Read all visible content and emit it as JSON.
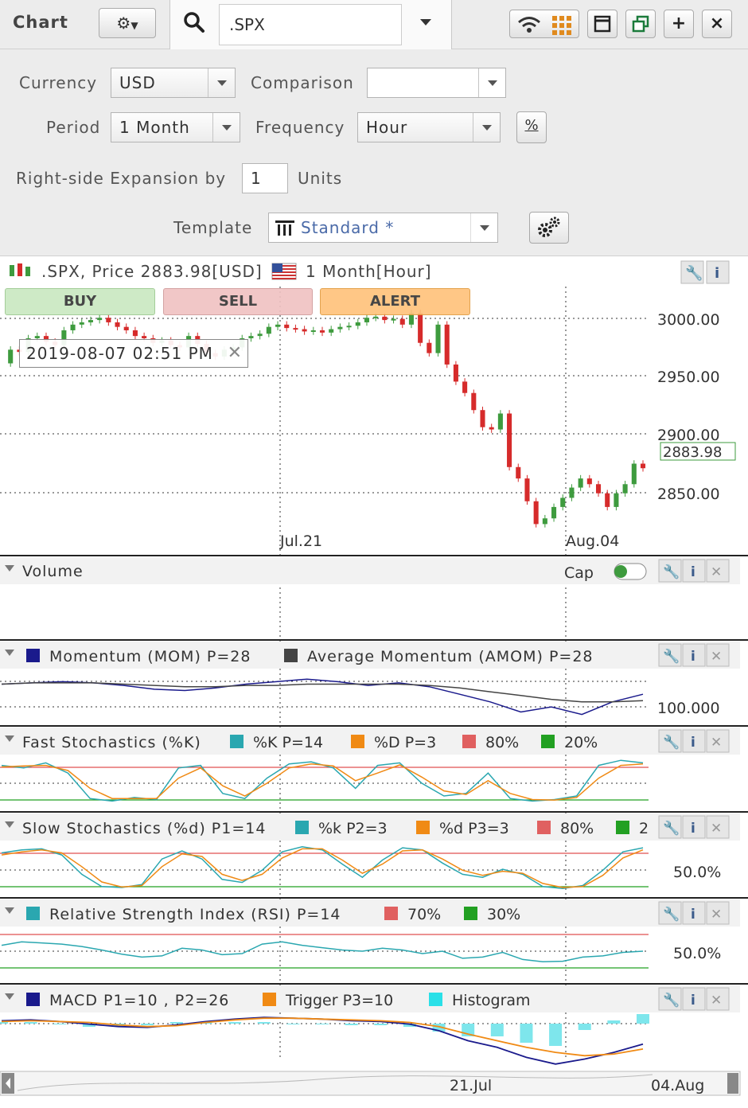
{
  "toolbar": {
    "title": "Chart",
    "symbol": ".SPX",
    "maximize_label": "+",
    "close_label": "×"
  },
  "settings": {
    "currency_label": "Currency",
    "currency_value": "USD",
    "comparison_label": "Comparison",
    "comparison_value": "",
    "period_label": "Period",
    "period_value": "1 Month",
    "frequency_label": "Frequency",
    "frequency_value": "Hour",
    "percent_label": "%",
    "expansion_label": "Right-side Expansion by",
    "expansion_value": "1",
    "units_label": "Units",
    "template_label": "Template",
    "template_value": "Standard *"
  },
  "price_panel": {
    "header": ".SPX, Price 2883.98[USD]",
    "period": "1 Month[Hour]",
    "buy_label": "BUY",
    "sell_label": "SELL",
    "alert_label": "ALERT",
    "crosshair_date": "2019-08-07 02:51 PM",
    "last_price": "2883.98",
    "y_ticks": [
      "3000.00",
      "2950.00",
      "2900.00",
      "2850.00"
    ],
    "x_ticks": [
      "Jul.21",
      "Aug.04"
    ]
  },
  "panels": {
    "volume": {
      "title": "Volume",
      "cap_label": "Cap"
    },
    "momentum": {
      "name1": "Momentum (MOM) P=28",
      "name2": "Average Momentum (AMOM) P=28",
      "tick": "100.000",
      "color1": "#1a1a8c",
      "color2": "#444444"
    },
    "fast_stoch": {
      "title": "Fast Stochastics (%K)",
      "k": "%K P=14",
      "d": "%D P=3",
      "hi": "80%",
      "lo": "20%"
    },
    "slow_stoch": {
      "title": "Slow Stochastics (%d) P1=14",
      "k": "%k P2=3",
      "d": "%d P3=3",
      "hi": "80%",
      "lo": "2",
      "tick": "50.0%"
    },
    "rsi": {
      "title": "Relative Strength Index (RSI) P=14",
      "hi": "70%",
      "lo": "30%",
      "tick": "50.0%"
    },
    "macd": {
      "title": "MACD P1=10 , P2=26",
      "trigger": "Trigger P3=10",
      "hist": "Histogram"
    }
  },
  "navigator": {
    "labels": [
      "21.Jul",
      "04.Aug"
    ]
  },
  "colors": {
    "up": "#3e9b3e",
    "down": "#d62b2b",
    "cyan": "#2aa7b0",
    "orange": "#f08a14",
    "red_line": "#e05050",
    "green_line": "#22a022"
  },
  "chart_data": [
    {
      "type": "line",
      "title": ".SPX, Price 2883.98[USD]",
      "xlabel": "",
      "ylabel": "",
      "x_ticks": [
        "Jul.21",
        "Aug.04"
      ],
      "ylim": [
        2822,
        3042
      ],
      "series": [
        {
          "name": ".SPX",
          "values": [
            2976,
            2988,
            2986,
            2998,
            3000,
            2995,
            2992,
            3005,
            3010,
            3012,
            3014,
            3016,
            3012,
            3008,
            3005,
            3000,
            2998,
            2994,
            2996,
            2992,
            2990,
            3000,
            2993,
            2985,
            2982,
            2988,
            2990,
            2998,
            3000,
            3002,
            3008,
            3010,
            3007,
            3006,
            3004,
            3005,
            3003,
            3006,
            3008,
            3009,
            3012,
            3016,
            3017,
            3014,
            3015,
            3010,
            3020,
            2994,
            2985,
            3010,
            2975,
            2960,
            2950,
            2935,
            2920,
            2918,
            2932,
            2885,
            2875,
            2855,
            2835,
            2840,
            2850,
            2858,
            2867,
            2875,
            2870,
            2862,
            2850,
            2862,
            2870,
            2888,
            2884
          ]
        }
      ]
    },
    {
      "type": "line",
      "title": "Momentum (MOM) P=28",
      "y_ticks": [
        "100.000"
      ],
      "series": [
        {
          "name": "Momentum (MOM) P=28",
          "values": [
            100.4,
            100.5,
            100.6,
            100.5,
            100.3,
            100.0,
            99.9,
            100.1,
            100.4,
            100.6,
            100.8,
            100.6,
            100.3,
            100.5,
            100.2,
            99.6,
            99.0,
            98.2,
            98.6,
            98.0,
            99.0,
            99.6
          ]
        },
        {
          "name": "Average Momentum (AMOM) P=28",
          "values": [
            100.4,
            100.5,
            100.5,
            100.5,
            100.4,
            100.3,
            100.2,
            100.2,
            100.3,
            100.3,
            100.4,
            100.4,
            100.4,
            100.4,
            100.3,
            100.1,
            99.8,
            99.5,
            99.2,
            99.0,
            99.0,
            99.1
          ]
        }
      ]
    },
    {
      "type": "line",
      "title": "Fast Stochastics (%K)",
      "ylim": [
        0,
        100
      ],
      "series": [
        {
          "name": "%K P=14",
          "values": [
            85,
            80,
            90,
            70,
            20,
            15,
            22,
            18,
            80,
            85,
            30,
            20,
            60,
            88,
            92,
            80,
            40,
            85,
            90,
            50,
            25,
            30,
            70,
            20,
            15,
            18,
            25,
            85,
            95,
            90
          ]
        },
        {
          "name": "%D P=3",
          "values": [
            82,
            84,
            85,
            75,
            40,
            20,
            20,
            20,
            60,
            80,
            45,
            25,
            50,
            80,
            88,
            84,
            55,
            70,
            86,
            62,
            35,
            28,
            55,
            30,
            18,
            17,
            22,
            60,
            85,
            88
          ]
        }
      ]
    },
    {
      "type": "line",
      "title": "Slow Stochastics (%d) P1=14",
      "y_ticks": [
        "50.0%"
      ],
      "ylim": [
        0,
        100
      ],
      "series": [
        {
          "name": "%k P2=3",
          "values": [
            82,
            88,
            90,
            78,
            40,
            16,
            14,
            20,
            70,
            86,
            70,
            30,
            24,
            48,
            84,
            94,
            88,
            60,
            34,
            68,
            92,
            88,
            62,
            40,
            34,
            50,
            40,
            16,
            12,
            18,
            48,
            84,
            92
          ]
        },
        {
          "name": "%d P3=3",
          "values": [
            78,
            84,
            88,
            82,
            55,
            25,
            15,
            18,
            55,
            80,
            75,
            40,
            28,
            40,
            72,
            90,
            90,
            68,
            42,
            60,
            86,
            88,
            70,
            48,
            38,
            46,
            42,
            22,
            14,
            16,
            38,
            72,
            88
          ]
        }
      ]
    },
    {
      "type": "line",
      "title": "Relative Strength Index (RSI) P=14",
      "y_ticks": [
        "50.0%"
      ],
      "ylim": [
        0,
        100
      ],
      "series": [
        {
          "name": "RSI",
          "values": [
            60,
            66,
            64,
            62,
            58,
            52,
            45,
            40,
            42,
            55,
            52,
            44,
            46,
            62,
            66,
            60,
            56,
            52,
            50,
            55,
            52,
            46,
            50,
            38,
            40,
            48,
            36,
            32,
            33,
            40,
            42,
            48,
            50
          ]
        }
      ]
    },
    {
      "type": "line",
      "title": "MACD P1=10 , P2=26",
      "series": [
        {
          "name": "MACD",
          "values": [
            2,
            3,
            1,
            -2,
            -5,
            -6,
            -3,
            1,
            4,
            6,
            5,
            4,
            2,
            1,
            -2,
            -10,
            -22,
            -30,
            -42,
            -50,
            -44,
            -36,
            -26
          ]
        },
        {
          "name": "Trigger P3=10",
          "values": [
            1,
            2,
            1,
            0,
            -3,
            -5,
            -4,
            0,
            3,
            5,
            5,
            4,
            3,
            2,
            0,
            -5,
            -14,
            -22,
            -30,
            -36,
            -40,
            -38,
            -32
          ]
        },
        {
          "name": "Histogram",
          "values": [
            1,
            1,
            0,
            -2,
            -2,
            -1,
            1,
            1,
            1,
            1,
            0,
            0,
            -1,
            -1,
            -2,
            -5,
            -8,
            -8,
            -12,
            -14,
            -4,
            2,
            6
          ]
        }
      ]
    }
  ]
}
